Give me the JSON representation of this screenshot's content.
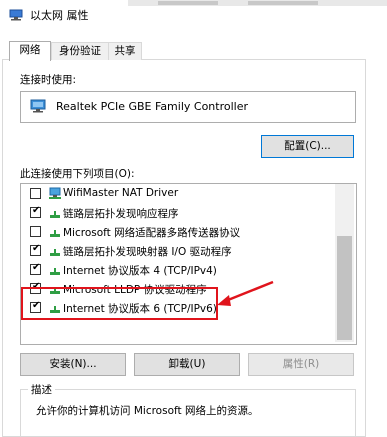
{
  "window": {
    "title": "以太网 属性",
    "tabs": [
      {
        "label": "网络"
      },
      {
        "label": "身份验证"
      },
      {
        "label": "共享"
      }
    ]
  },
  "network": {
    "connect_using_label": "连接时使用:",
    "adapter_name": "Realtek PCIe GBE Family Controller",
    "configure_button": "配置(C)...",
    "items_label": "此连接使用下列项目(O):",
    "items": [
      {
        "label": "WifiMaster NAT Driver",
        "checked": false,
        "icon": "network-component-icon"
      },
      {
        "label": "链路层拓扑发现响应程序",
        "checked": true,
        "icon": "protocol-icon"
      },
      {
        "label": "Microsoft 网络适配器多路传送器协议",
        "checked": false,
        "icon": "protocol-icon"
      },
      {
        "label": "链路层拓扑发现映射器 I/O 驱动程序",
        "checked": true,
        "icon": "protocol-icon"
      },
      {
        "label": "Internet 协议版本 4 (TCP/IPv4)",
        "checked": true,
        "icon": "protocol-icon"
      },
      {
        "label": "Microsoft LLDP 协议驱动程序",
        "checked": true,
        "icon": "protocol-icon"
      },
      {
        "label": "Internet 协议版本 6 (TCP/IPv6)",
        "checked": true,
        "icon": "protocol-icon"
      }
    ],
    "install_button": "安装(N)...",
    "uninstall_button": "卸载(U)",
    "properties_button": "属性(R)",
    "description_title": "描述",
    "description_text": "允许你的计算机访问 Microsoft 网络上的资源。"
  },
  "colors": {
    "annotation": "#e0141c",
    "focus_border": "#0078d7",
    "protocol_green": "#2f9e44"
  }
}
